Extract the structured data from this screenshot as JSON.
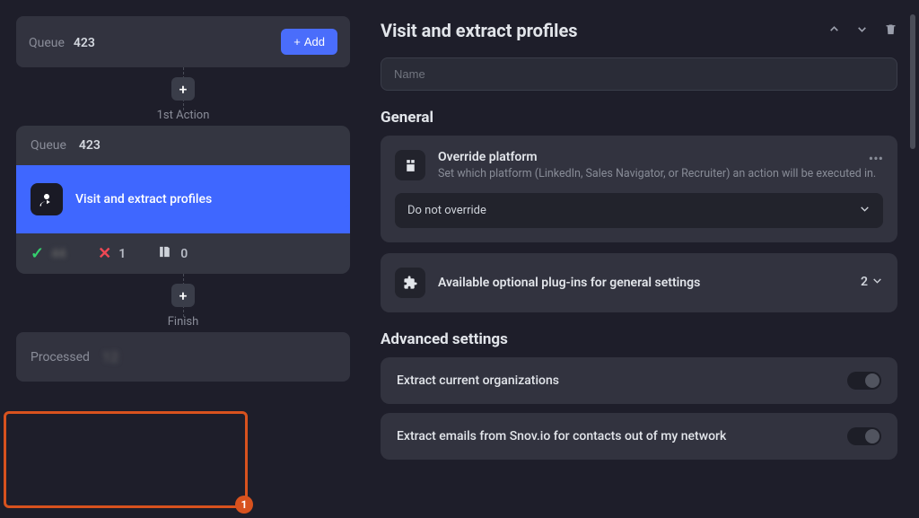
{
  "queue1": {
    "label": "Queue",
    "value": "423",
    "add_label": "Add"
  },
  "action1": {
    "label": "1st Action",
    "queue_label": "Queue",
    "queue_value": "423",
    "title": "Visit and extract profiles",
    "success_count": "",
    "fail_count": "1",
    "other_count": "0"
  },
  "finish": {
    "label": "Finish",
    "processed_label": "Processed"
  },
  "highlight_badge": "1",
  "panel": {
    "title": "Visit and extract profiles",
    "name_placeholder": "Name",
    "section_general": "General",
    "override": {
      "title": "Override platform",
      "desc": "Set which platform (LinkedIn, Sales Navigator, or Recruiter) an action will be executed in.",
      "selected": "Do not override"
    },
    "plugins": {
      "title": "Available optional plug-ins for general settings",
      "count": "2"
    },
    "section_advanced": "Advanced settings",
    "toggles": [
      "Extract current organizations",
      "Extract emails from Snov.io for contacts out of my network"
    ]
  }
}
